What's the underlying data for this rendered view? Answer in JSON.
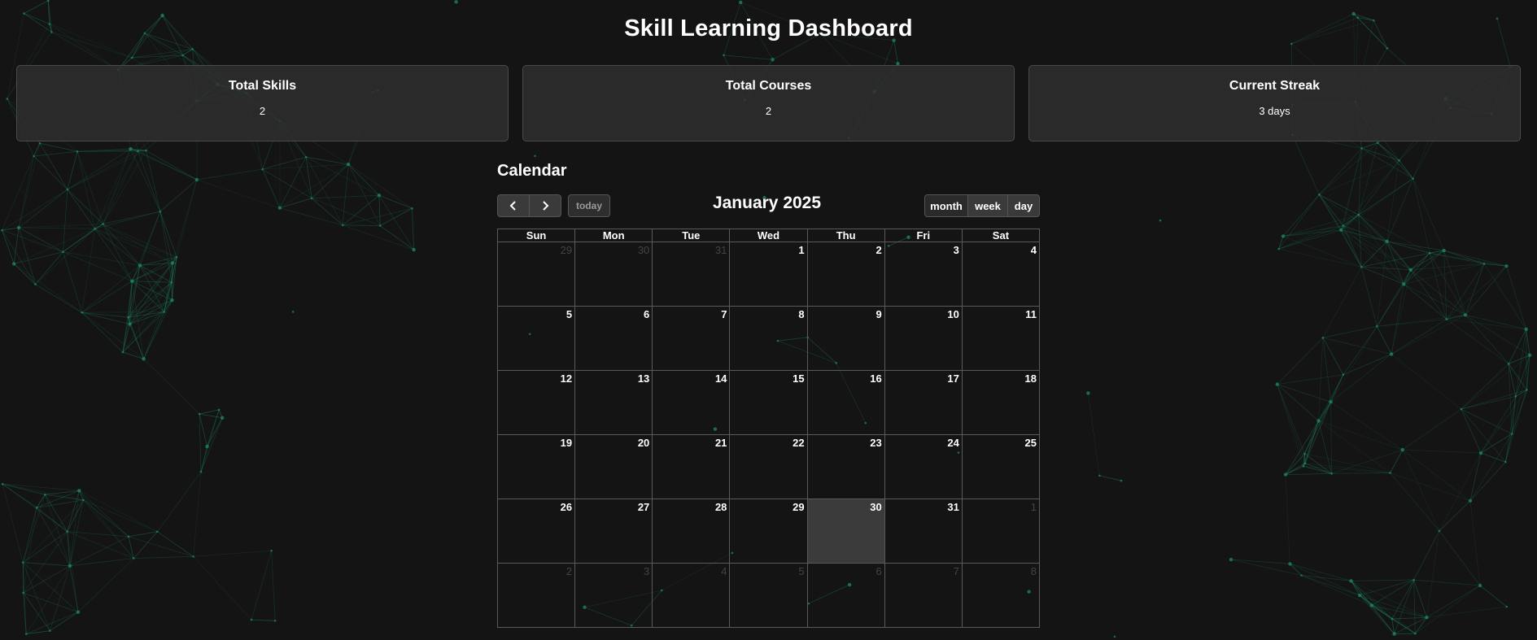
{
  "page_title": "Skill Learning Dashboard",
  "stats": [
    {
      "title": "Total Skills",
      "value": "2"
    },
    {
      "title": "Total Courses",
      "value": "2"
    },
    {
      "title": "Current Streak",
      "value": "3 days"
    }
  ],
  "calendar": {
    "heading": "Calendar",
    "title": "January 2025",
    "today_label": "today",
    "views": [
      "month",
      "week",
      "day"
    ],
    "weekdays": [
      "Sun",
      "Mon",
      "Tue",
      "Wed",
      "Thu",
      "Fri",
      "Sat"
    ],
    "weeks": [
      [
        "29",
        "30",
        "31",
        "1",
        "2",
        "3",
        "4"
      ],
      [
        "5",
        "6",
        "7",
        "8",
        "9",
        "10",
        "11"
      ],
      [
        "12",
        "13",
        "14",
        "15",
        "16",
        "17",
        "18"
      ],
      [
        "19",
        "20",
        "21",
        "22",
        "23",
        "24",
        "25"
      ],
      [
        "26",
        "27",
        "28",
        "29",
        "30",
        "31",
        "1"
      ],
      [
        "2",
        "3",
        "4",
        "5",
        "6",
        "7",
        "8"
      ]
    ],
    "other_month": [
      [
        true,
        true,
        true,
        false,
        false,
        false,
        false
      ],
      [
        false,
        false,
        false,
        false,
        false,
        false,
        false
      ],
      [
        false,
        false,
        false,
        false,
        false,
        false,
        false
      ],
      [
        false,
        false,
        false,
        false,
        false,
        false,
        false
      ],
      [
        false,
        false,
        false,
        false,
        false,
        false,
        true
      ],
      [
        true,
        true,
        true,
        true,
        true,
        true,
        true
      ]
    ],
    "today_date": "30"
  },
  "icons": {
    "prev": "chevron-left-icon",
    "next": "chevron-right-icon"
  },
  "colors": {
    "background": "#141414",
    "network_lines": "#1f8f6a",
    "today_cell": "#3b3b3b"
  }
}
